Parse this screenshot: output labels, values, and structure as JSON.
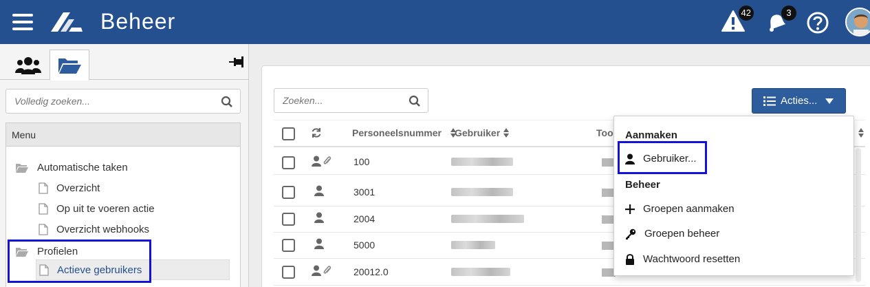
{
  "header": {
    "title": "Beheer",
    "alerts_count": "42",
    "notifications_count": "3"
  },
  "sidebar": {
    "search_placeholder": "Volledig zoeken...",
    "menu_title": "Menu",
    "items": [
      {
        "label": "Automatische taken",
        "type": "folder"
      },
      {
        "label": "Overzicht",
        "type": "page"
      },
      {
        "label": "Op uit te voeren actie",
        "type": "page"
      },
      {
        "label": "Overzicht webhooks",
        "type": "page"
      },
      {
        "label": "Profielen",
        "type": "folder"
      },
      {
        "label": "Actieve gebruikers",
        "type": "page",
        "active": true
      }
    ]
  },
  "main": {
    "search_placeholder": "Zoeken...",
    "actions_label": "Acties...",
    "columns": {
      "personeelsnummer": "Personeelsnummer",
      "gebruiker": "Gebruiker",
      "too": "Too"
    },
    "rows": [
      {
        "personeelsnummer": "100"
      },
      {
        "personeelsnummer": "3001"
      },
      {
        "personeelsnummer": "2004"
      },
      {
        "personeelsnummer": "5000"
      },
      {
        "personeelsnummer": "20012.0"
      }
    ]
  },
  "dropdown": {
    "section_create": "Aanmaken",
    "create_user": "Gebruiker...",
    "section_manage": "Beheer",
    "create_groups": "Groepen aanmaken",
    "manage_groups": "Groepen beheer",
    "reset_password": "Wachtwoord resetten"
  },
  "colors": {
    "header_bg": "#24508f",
    "actions_button": "#2d5d9c",
    "highlight": "#1212d8"
  }
}
